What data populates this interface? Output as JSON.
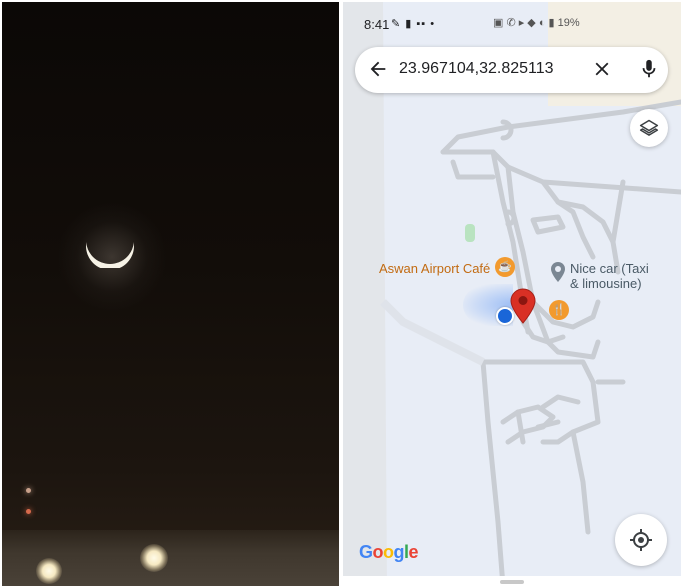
{
  "status_bar": {
    "time": "8:41",
    "icons_left": "✎ ▮ ▪▪ •",
    "icons_right": "▣ ✆ ▸ ◆ ◐ ▮ 19%"
  },
  "search": {
    "query": "23.967104,32.825113"
  },
  "map": {
    "pois": [
      {
        "name": "Aswan Airport Café",
        "type": "cafe"
      },
      {
        "name_line1": "Nice car (Taxi",
        "name_line2": "& limousine)",
        "type": "car-service"
      }
    ],
    "logo_text": "Google"
  },
  "colors": {
    "map_bg": "#e8edf6",
    "road": "#c9cdd3",
    "pin": "#d93025",
    "my_location": "#1a66d8",
    "poi_orange": "#f29a2e"
  }
}
